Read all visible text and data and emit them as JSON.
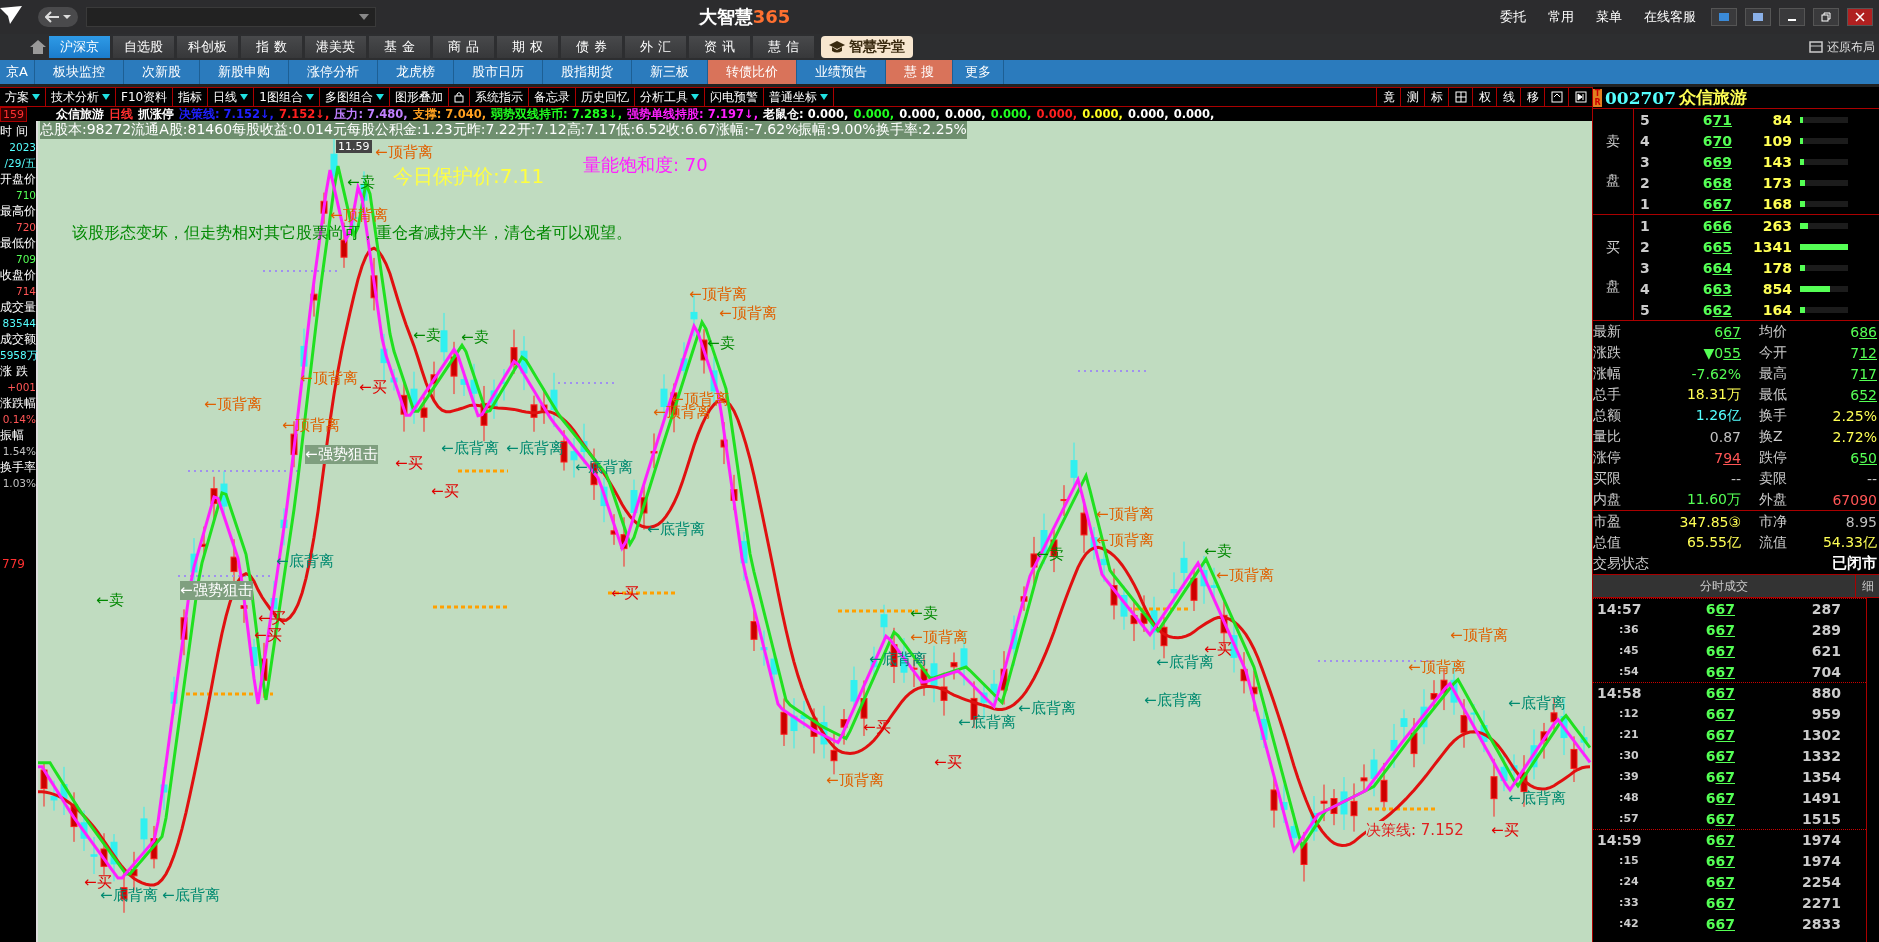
{
  "title_bar": {
    "logo_text": "大智慧",
    "logo_number": "365",
    "links": [
      "委托",
      "常用",
      "菜单",
      "在线客服"
    ],
    "restore_layout": "还原布局"
  },
  "market_tabs": [
    {
      "label": "沪深京",
      "selected": true
    },
    {
      "label": "自选股",
      "selected": false
    },
    {
      "label": "科创板",
      "selected": false
    },
    {
      "label": "指 数",
      "selected": false
    },
    {
      "label": "港美英",
      "selected": false
    },
    {
      "label": "基 金",
      "selected": false
    },
    {
      "label": "商 品",
      "selected": false
    },
    {
      "label": "期 权",
      "selected": false
    },
    {
      "label": "债 券",
      "selected": false
    },
    {
      "label": "外 汇",
      "selected": false
    },
    {
      "label": "资 讯",
      "selected": false
    },
    {
      "label": "慧 信",
      "selected": false
    }
  ],
  "academy_button": "智慧学堂",
  "feature_tabs": [
    {
      "label": "京A",
      "highlighted": false
    },
    {
      "label": "板块监控",
      "highlighted": false
    },
    {
      "label": "次新股",
      "highlighted": false
    },
    {
      "label": "新股申购",
      "highlighted": false
    },
    {
      "label": "涨停分析",
      "highlighted": false
    },
    {
      "label": "龙虎榜",
      "highlighted": false
    },
    {
      "label": "股市日历",
      "highlighted": false
    },
    {
      "label": "股指期货",
      "highlighted": false
    },
    {
      "label": "新三板",
      "highlighted": false
    },
    {
      "label": "转债比价",
      "highlighted": true
    },
    {
      "label": "业绩预告",
      "highlighted": false
    },
    {
      "label": "慧 搜",
      "highlighted": true
    },
    {
      "label": "更多",
      "highlighted": false
    }
  ],
  "tool_tabs": [
    {
      "kind": "text",
      "label": "方案",
      "dropdown": true
    },
    {
      "kind": "text",
      "label": "技术分析",
      "dropdown": true
    },
    {
      "kind": "text",
      "label": "F10资料",
      "dropdown": false
    },
    {
      "kind": "text",
      "label": "指标",
      "dropdown": false
    },
    {
      "kind": "text",
      "label": "日线",
      "dropdown": true
    },
    {
      "kind": "text",
      "label": "1图组合",
      "dropdown": true
    },
    {
      "kind": "text",
      "label": "多图组合",
      "dropdown": true
    },
    {
      "kind": "text",
      "label": "图形叠加",
      "dropdown": false
    },
    {
      "kind": "lock"
    },
    {
      "kind": "text",
      "label": "系统指示",
      "dropdown": false
    },
    {
      "kind": "text",
      "label": "备忘录",
      "dropdown": false
    },
    {
      "kind": "text",
      "label": "历史回忆",
      "dropdown": false
    },
    {
      "kind": "text",
      "label": "分析工具",
      "dropdown": true
    },
    {
      "kind": "text",
      "label": "闪电预警",
      "dropdown": false
    },
    {
      "kind": "text",
      "label": "普通坐标",
      "dropdown": true
    }
  ],
  "chart_tools": [
    {
      "kind": "text",
      "label": "竟"
    },
    {
      "kind": "text",
      "label": "测"
    },
    {
      "kind": "text",
      "label": "标"
    },
    {
      "kind": "grid"
    },
    {
      "kind": "text",
      "label": "权"
    },
    {
      "kind": "text",
      "label": "线"
    },
    {
      "kind": "text",
      "label": "移"
    },
    {
      "kind": "window"
    },
    {
      "kind": "play"
    }
  ],
  "stock_header": {
    "badge": "TR",
    "code": "002707",
    "name": "众信旅游"
  },
  "indicator_line": [
    {
      "text": "众信旅游",
      "color": "#ffffff"
    },
    {
      "text": "日线",
      "color": "#ff3030"
    },
    {
      "text": "抓涨停",
      "color": "#ffffff"
    },
    {
      "text": "决策线: 7.152↓,",
      "color": "#2020ff"
    },
    {
      "text": "7.152↓,",
      "color": "#ff2020"
    },
    {
      "text": "压力: 7.480,",
      "color": "#c080ff"
    },
    {
      "text": "支撑: 7.040,",
      "color": "#ffa020"
    },
    {
      "text": "弱势双线持币: 7.283↓,",
      "color": "#20ff20"
    },
    {
      "text": "强势单线持股: 7.197↓,",
      "color": "#ff20ff"
    },
    {
      "text": "老鼠仓: 0.000,",
      "color": "#ffffff"
    },
    {
      "text": "0.000,",
      "color": "#20ff20"
    },
    {
      "text": "0.000,",
      "color": "#ffffff"
    },
    {
      "text": "0.000,",
      "color": "#ffffff"
    },
    {
      "text": "0.000,",
      "color": "#20ff20"
    },
    {
      "text": "0.000,",
      "color": "#ff2020"
    },
    {
      "text": "0.000,",
      "color": "#ffff20"
    },
    {
      "text": "0.000,",
      "color": "#ffffff"
    },
    {
      "text": "0.000,",
      "color": "#ffffff"
    }
  ],
  "info_line": "总股本:98272流通A股:81460每股收益:0.014元每股公积金:1.23元昨:7.22开:7.12高:7.17低:6.52收:6.67涨幅:-7.62%振幅:9.00%换手率:2.25%",
  "left_panel": {
    "top_price": "159",
    "price_mark": "779",
    "lines": [
      {
        "kind": "label",
        "text": "时 间"
      },
      {
        "kind": "value",
        "text": "2023",
        "color": "#55ffff"
      },
      {
        "kind": "value",
        "text": "/29/五",
        "color": "#55ffff"
      },
      {
        "kind": "label",
        "text": "开盘价"
      },
      {
        "kind": "value",
        "text": "710",
        "color": "#55ff55"
      },
      {
        "kind": "label",
        "text": "最高价"
      },
      {
        "kind": "value",
        "text": "720",
        "color": "#ff5555"
      },
      {
        "kind": "label",
        "text": "最低价"
      },
      {
        "kind": "value",
        "text": "709",
        "color": "#55ff55"
      },
      {
        "kind": "label",
        "text": "收盘价"
      },
      {
        "kind": "value",
        "text": "714",
        "color": "#ff5555"
      },
      {
        "kind": "label",
        "text": "成交量"
      },
      {
        "kind": "value",
        "text": "83544",
        "color": "#55ffff"
      },
      {
        "kind": "label",
        "text": "成交额"
      },
      {
        "kind": "value",
        "text": "5958万",
        "color": "#55ffff"
      },
      {
        "kind": "label",
        "text": "涨 跌"
      },
      {
        "kind": "value",
        "text": "+001",
        "color": "#ff5555"
      },
      {
        "kind": "label",
        "text": "涨跌幅"
      },
      {
        "kind": "value",
        "text": "0.14%",
        "color": "#ff5555"
      },
      {
        "kind": "label",
        "text": "振幅"
      },
      {
        "kind": "value",
        "text": "1.54%",
        "color": "#c0c0c0"
      },
      {
        "kind": "label",
        "text": "换手率"
      },
      {
        "kind": "value",
        "text": "1.03%",
        "color": "#c0c0c0"
      }
    ]
  },
  "chart": {
    "high_label": "11.59",
    "protect_price": "今日保护价:7.11",
    "comment": "该股形态变坏，但走势相对其它股票尚可，重仓者减持大半，清仓者可以观望。",
    "saturation": "量能饱和度: 70",
    "annotations": [
      {
        "kind": "top",
        "text": "←顶背离"
      },
      {
        "kind": "sell",
        "text": "←卖"
      },
      {
        "kind": "top",
        "text": "←顶背离"
      },
      {
        "kind": "top",
        "text": "←顶背离"
      },
      {
        "kind": "top",
        "text": "←顶背离"
      },
      {
        "kind": "top",
        "text": "←顶背离"
      },
      {
        "kind": "snipe",
        "text": "←强势狙击"
      },
      {
        "kind": "bottom",
        "text": "←底背离"
      },
      {
        "kind": "snipe",
        "text": "←强势狙击"
      },
      {
        "kind": "buy",
        "text": "←买"
      },
      {
        "kind": "buy",
        "text": "←买"
      },
      {
        "kind": "sell",
        "text": "←卖"
      },
      {
        "kind": "buy",
        "text": "←买"
      },
      {
        "kind": "bottom",
        "text": "←底背离"
      },
      {
        "kind": "bottom",
        "text": "←底背离"
      },
      {
        "kind": "sell",
        "text": "←卖"
      },
      {
        "kind": "sell",
        "text": "←卖"
      },
      {
        "kind": "buy",
        "text": "←买"
      },
      {
        "kind": "buy",
        "text": "←买"
      },
      {
        "kind": "bottom",
        "text": "←底背离"
      },
      {
        "kind": "buy",
        "text": "←买"
      },
      {
        "kind": "bottom",
        "text": "←底背离"
      },
      {
        "kind": "bottom",
        "text": "←底背离"
      },
      {
        "kind": "bottom",
        "text": "←底背离"
      },
      {
        "kind": "buy",
        "text": "←买"
      },
      {
        "kind": "top",
        "text": "←顶背离"
      },
      {
        "kind": "top",
        "text": "←顶背离"
      },
      {
        "kind": "sell",
        "text": "←卖"
      },
      {
        "kind": "top",
        "text": "←顶背离"
      },
      {
        "kind": "top",
        "text": "←顶背离"
      },
      {
        "kind": "top",
        "text": "←顶背离"
      },
      {
        "kind": "sell",
        "text": "←卖"
      },
      {
        "kind": "top",
        "text": "←顶背离"
      },
      {
        "kind": "sell",
        "text": "←卖"
      },
      {
        "kind": "top",
        "text": "←顶背离"
      },
      {
        "kind": "sell",
        "text": "←卖"
      },
      {
        "kind": "top",
        "text": "←顶背离"
      },
      {
        "kind": "bottom",
        "text": "←底背离"
      },
      {
        "kind": "bottom",
        "text": "←底背离"
      },
      {
        "kind": "buy",
        "text": "←买"
      },
      {
        "kind": "bottom",
        "text": "←底背离"
      },
      {
        "kind": "bottom",
        "text": "←底背离"
      },
      {
        "kind": "bottom",
        "text": "←底背离"
      },
      {
        "kind": "buy",
        "text": "←买"
      },
      {
        "kind": "buy",
        "text": "←买"
      },
      {
        "kind": "top",
        "text": "←顶背离"
      },
      {
        "kind": "top",
        "text": "←顶背离"
      },
      {
        "kind": "top",
        "text": "←顶背离"
      },
      {
        "kind": "bottom",
        "text": "←底背离"
      },
      {
        "kind": "bottom",
        "text": "←底背离"
      },
      {
        "kind": "decision",
        "text": "决策线: 7.152"
      },
      {
        "kind": "buy",
        "text": "←买"
      }
    ]
  },
  "order_book": {
    "sell_label": [
      "卖",
      "盘"
    ],
    "buy_label": [
      "买",
      "盘"
    ],
    "sell": [
      {
        "no": "5",
        "price": "671",
        "volume": "84",
        "level": 0.06
      },
      {
        "no": "4",
        "price": "670",
        "volume": "109",
        "level": 0.07
      },
      {
        "no": "3",
        "price": "669",
        "volume": "143",
        "level": 0.09
      },
      {
        "no": "2",
        "price": "668",
        "volume": "173",
        "level": 0.11
      },
      {
        "no": "1",
        "price": "667",
        "volume": "168",
        "level": 0.11
      }
    ],
    "buy": [
      {
        "no": "1",
        "price": "666",
        "volume": "263",
        "level": 0.17
      },
      {
        "no": "2",
        "price": "665",
        "volume": "1341",
        "level": 1
      },
      {
        "no": "3",
        "price": "664",
        "volume": "178",
        "level": 0.11
      },
      {
        "no": "4",
        "price": "663",
        "volume": "854",
        "level": 0.63
      },
      {
        "no": "5",
        "price": "662",
        "volume": "164",
        "level": 0.1
      }
    ]
  },
  "quote_stats": [
    {
      "label": "最新",
      "value": {
        "text": "667",
        "kind": "price",
        "color": "#55ff55"
      },
      "label2": "均价",
      "value2": {
        "text": "686",
        "kind": "price",
        "color": "#55ff55"
      }
    },
    {
      "label": "涨跌",
      "value": {
        "text": "▼055",
        "kind": "price",
        "color": "#55ff55"
      },
      "label2": "今开",
      "value2": {
        "text": "712",
        "kind": "price",
        "color": "#55ff55"
      }
    },
    {
      "label": "涨幅",
      "value": {
        "text": "-7.62%",
        "kind": "plain",
        "color": "#55ff55"
      },
      "label2": "最高",
      "value2": {
        "text": "717",
        "kind": "price",
        "color": "#55ff55"
      }
    },
    {
      "label": "总手",
      "value": {
        "text": "18.31万",
        "kind": "plain",
        "color": "#ffff55"
      },
      "label2": "最低",
      "value2": {
        "text": "652",
        "kind": "price",
        "color": "#55ff55"
      }
    },
    {
      "label": "总额",
      "value": {
        "text": "1.26亿",
        "kind": "plain",
        "color": "#55ffff"
      },
      "label2": "换手",
      "value2": {
        "text": "2.25%",
        "kind": "plain",
        "color": "#ffff55"
      }
    },
    {
      "label": "量比",
      "value": {
        "text": "0.87",
        "kind": "plain",
        "color": "#c0c0c0"
      },
      "label2": "换Z",
      "value2": {
        "text": "2.72%",
        "kind": "plain",
        "color": "#ffff55"
      }
    },
    {
      "label": "涨停",
      "value": {
        "text": "794",
        "kind": "price",
        "color": "#ff5555"
      },
      "label2": "跌停",
      "value2": {
        "text": "650",
        "kind": "price",
        "color": "#55ff55"
      }
    },
    {
      "label": "买限",
      "value": {
        "text": "--",
        "kind": "plain",
        "color": "#c0c0c0"
      },
      "label2": "卖限",
      "value2": {
        "text": "--",
        "kind": "plain",
        "color": "#c0c0c0"
      }
    },
    {
      "label": "内盘",
      "value": {
        "text": "11.60万",
        "kind": "plain",
        "color": "#55ff55"
      },
      "label2": "外盘",
      "value2": {
        "text": "67090",
        "kind": "plain",
        "color": "#ff5555"
      }
    }
  ],
  "valuation_stats": [
    {
      "label": "市盈",
      "value": {
        "text": "347.85③",
        "kind": "plain",
        "color": "#ffff55"
      },
      "label2": "市净",
      "value2": {
        "text": "8.95",
        "kind": "plain",
        "color": "#c0c0c0"
      }
    },
    {
      "label": "总值",
      "value": {
        "text": "65.55亿",
        "kind": "plain",
        "color": "#ffff55"
      },
      "label2": "流值",
      "value2": {
        "text": "54.33亿",
        "kind": "plain",
        "color": "#ffff55"
      }
    }
  ],
  "trade_status": {
    "label": "交易状态",
    "value": "已闭市"
  },
  "trades": {
    "title": "分时成交",
    "tab": "细",
    "rows": [
      {
        "time": "14:57",
        "price": "667",
        "volume": "287",
        "minute_start": true
      },
      {
        "time": ":36",
        "price": "667",
        "volume": "289",
        "minute_start": false
      },
      {
        "time": ":45",
        "price": "667",
        "volume": "621",
        "minute_start": false
      },
      {
        "time": ":54",
        "price": "667",
        "volume": "704",
        "minute_start": false
      },
      {
        "time": "14:58",
        "price": "667",
        "volume": "880",
        "minute_start": true
      },
      {
        "time": ":12",
        "price": "667",
        "volume": "959",
        "minute_start": false
      },
      {
        "time": ":21",
        "price": "667",
        "volume": "1302",
        "minute_start": false
      },
      {
        "time": ":30",
        "price": "667",
        "volume": "1332",
        "minute_start": false
      },
      {
        "time": ":39",
        "price": "667",
        "volume": "1354",
        "minute_start": false
      },
      {
        "time": ":48",
        "price": "667",
        "volume": "1491",
        "minute_start": false
      },
      {
        "time": ":57",
        "price": "667",
        "volume": "1515",
        "minute_start": false
      },
      {
        "time": "14:59",
        "price": "667",
        "volume": "1974",
        "minute_start": true
      },
      {
        "time": ":15",
        "price": "667",
        "volume": "1974",
        "minute_start": false
      },
      {
        "time": ":24",
        "price": "667",
        "volume": "2254",
        "minute_start": false
      },
      {
        "time": ":33",
        "price": "667",
        "volume": "2271",
        "minute_start": false
      },
      {
        "time": ":42",
        "price": "667",
        "volume": "2833",
        "minute_start": false
      }
    ]
  }
}
